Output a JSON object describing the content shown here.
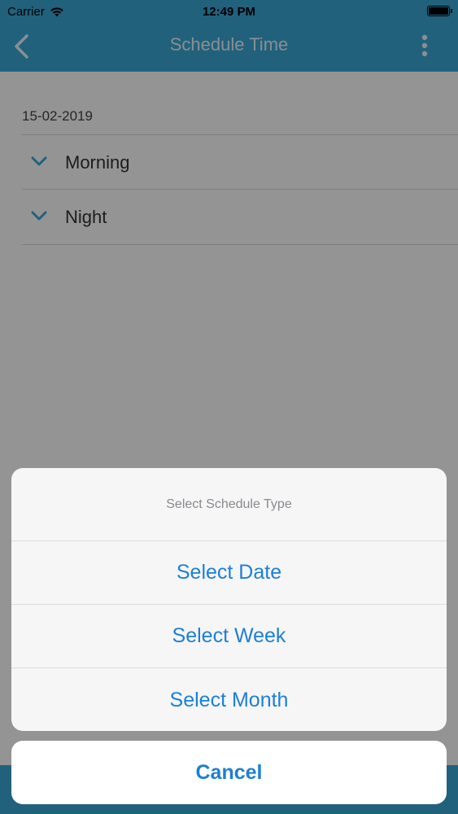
{
  "status_bar": {
    "carrier": "Carrier",
    "time": "12:49 PM"
  },
  "nav": {
    "title": "Schedule Time"
  },
  "content": {
    "date": "15-02-2019",
    "sections": [
      {
        "label": "Morning"
      },
      {
        "label": "Night"
      }
    ]
  },
  "action_sheet": {
    "title": "Select Schedule Type",
    "options": [
      {
        "label": "Select Date"
      },
      {
        "label": "Select Week"
      },
      {
        "label": "Select Month"
      }
    ],
    "cancel_label": "Cancel"
  },
  "colors": {
    "nav_bar": "#3aa7d6",
    "action_text": "#1d7fd6",
    "chevron": "#3aa7d6"
  }
}
